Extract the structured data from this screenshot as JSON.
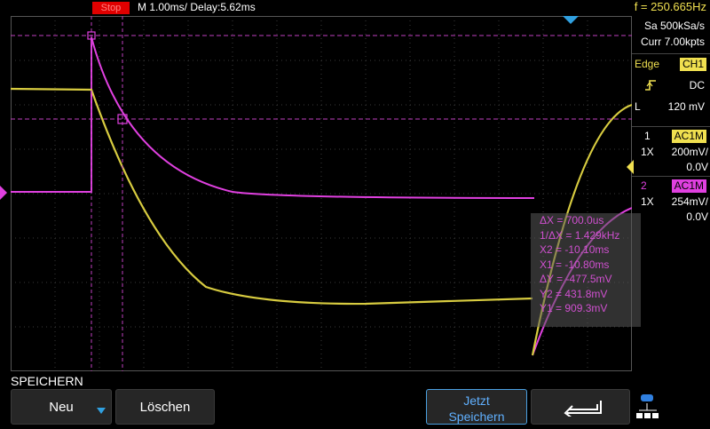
{
  "top": {
    "status": "Stop",
    "timebase": "M 1.00ms/ Delay:5.62ms",
    "frequency": "f = 250.665Hz"
  },
  "acquisition": {
    "sample_rate": "Sa 500kSa/s",
    "memory": "Curr 7.00kpts"
  },
  "trigger": {
    "mode": "Edge",
    "source": "CH1",
    "coupling": "DC",
    "level_label": "L",
    "level": "120 mV"
  },
  "channels": [
    {
      "number": "1",
      "badge": "AC1M",
      "probe": "1X",
      "scale": "200mV/",
      "offset": "0.0V",
      "color": "#f0e050"
    },
    {
      "number": "2",
      "badge": "AC1M",
      "probe": "1X",
      "scale": "254mV/",
      "offset": "0.0V",
      "color": "#e040e0"
    }
  ],
  "measurements": [
    "ΔX = 700.0us",
    "1/ΔX = 1.429kHz",
    "X2 = -10.10ms",
    "X1 = -10.80ms",
    "ΔY = -477.5mV",
    "Y2 = 431.8mV",
    "Y1 = 909.3mV"
  ],
  "menu": {
    "title": "SPEICHERN",
    "new_label": "Neu",
    "delete_label": "Löschen",
    "save_now_line1": "Jetzt",
    "save_now_line2": "Speichern"
  },
  "colors": {
    "ch1": "#f0e050",
    "ch2": "#e040e0",
    "status_badge": "#e00000",
    "accent": "#4aa0e0"
  }
}
